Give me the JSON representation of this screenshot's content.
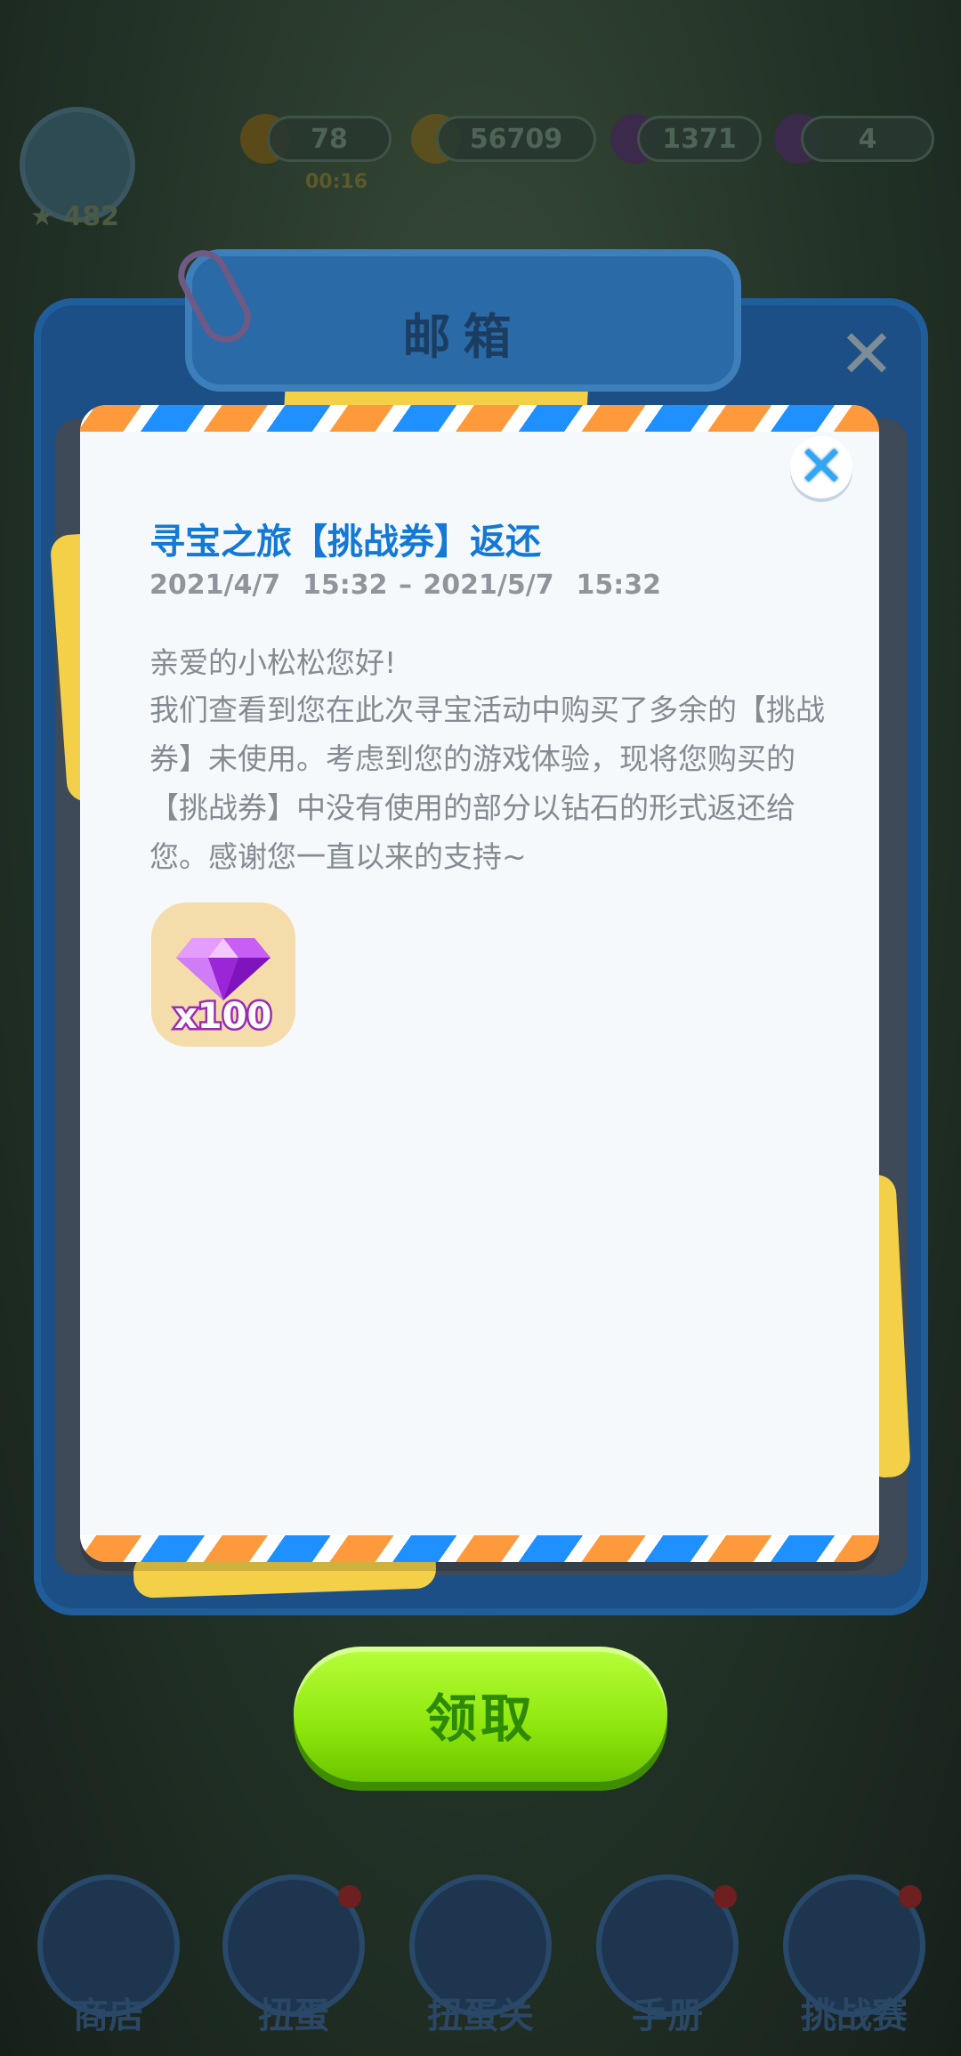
{
  "hud": {
    "energy": "78",
    "energy_timer": "00:16",
    "coins": "56709",
    "gems": "1371",
    "crowns": "4",
    "level": "482"
  },
  "mailbox": {
    "title": "邮箱"
  },
  "mail": {
    "title": "寻宝之旅【挑战券】返还",
    "date_range": "2021/4/7  15:32 – 2021/5/7  15:32",
    "greeting": "亲爱的小松松您好!",
    "body": "我们查看到您在此次寻宝活动中购买了多余的【挑战券】未使用。考虑到您的游戏体验，现将您购买的【挑战券】中没有使用的部分以钻石的形式返还给您。感谢您一直以来的支持~",
    "reward": {
      "icon": "diamond-icon",
      "count": "x100"
    }
  },
  "claim_button": {
    "label": "领取"
  },
  "bottom_nav": [
    {
      "label": "商店"
    },
    {
      "label": "扭蛋"
    },
    {
      "label": "扭蛋关"
    },
    {
      "label": "手册"
    },
    {
      "label": "挑战赛"
    }
  ],
  "colors": {
    "title_blue": "#1378d6",
    "claim_green": "#8ee60c",
    "stripe_orange": "#ff9a3c",
    "stripe_blue": "#1e90ff"
  }
}
